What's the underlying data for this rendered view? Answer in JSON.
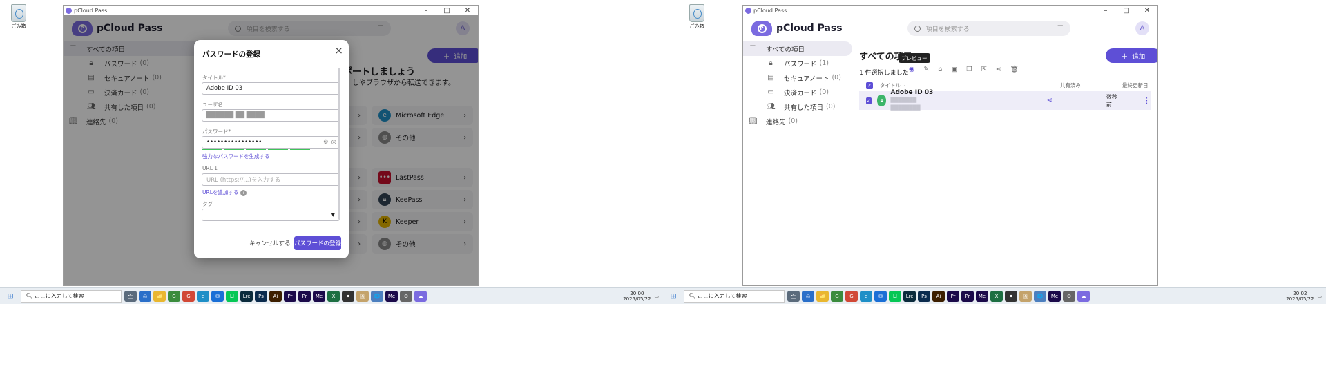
{
  "desktop": {
    "recycle_label": "ごみ箱"
  },
  "app": {
    "window_title": "pCloud Pass",
    "logo_text": "pCloud Pass",
    "search_placeholder": "項目を検索する",
    "avatar": "A",
    "add_button": "追加",
    "window_controls": {
      "min": "–",
      "max": "□",
      "close": "✕"
    }
  },
  "sidebar_left": [
    {
      "label": "すべての項目",
      "count": ""
    },
    {
      "label": "パスワード",
      "count": "(0)"
    },
    {
      "label": "セキュアノート",
      "count": "(0)"
    },
    {
      "label": "決済カード",
      "count": "(0)"
    },
    {
      "label": "共有した項目",
      "count": "(0)"
    },
    {
      "label": "連絡先",
      "count": "(0)"
    }
  ],
  "sidebar_right": [
    {
      "label": "すべての項目",
      "count": ""
    },
    {
      "label": "パスワード",
      "count": "(1)"
    },
    {
      "label": "セキュアノート",
      "count": "(0)"
    },
    {
      "label": "決済カード",
      "count": "(0)"
    },
    {
      "label": "共有した項目",
      "count": "(0)"
    },
    {
      "label": "連絡先",
      "count": "(0)"
    }
  ],
  "import": {
    "heading": "ポートしましょう",
    "subheading": "しやブラウザから転送できます。",
    "tiles": [
      "Microsoft Edge",
      "その他",
      "LastPass",
      "KeePass",
      "Keeper",
      "その他"
    ]
  },
  "modal": {
    "title": "パスワードの登録",
    "title_label": "タイトル*",
    "title_value": "Adobe ID 03",
    "username_label": "ユーザ名",
    "username_value": "██████ ██ ████",
    "password_label": "パスワード*",
    "password_value": "••••••••••••••••",
    "strength": 1.0,
    "generate_link": "強力なパスワードを生成する",
    "url_label": "URL 1",
    "url_placeholder": "URL (https://...)を入力する",
    "add_url_link": "URLを追加する",
    "tags_label": "タグ",
    "cancel": "キャンセルする",
    "submit": "パスワードの登録"
  },
  "right": {
    "page_title": "すべての項目",
    "tooltip": "プレビュー",
    "selected_text": "1 件選択しました",
    "columns": {
      "title": "タイトル",
      "shared": "共有済み",
      "updated": "最終更新日"
    },
    "row": {
      "title": "Adobe ID 03",
      "subtitle": "███████ ████████",
      "updated": "数秒前"
    }
  },
  "taskbar": {
    "search_placeholder": "ここに入力して検索",
    "left_clock": {
      "time": "20:00",
      "date": "2025/05/22"
    },
    "right_clock": {
      "time": "20:02",
      "date": "2025/05/22"
    },
    "apps": [
      "🗂",
      "◎",
      "📁",
      "G",
      "G",
      "e",
      "✉",
      "LI",
      "Lrc",
      "Ps",
      "Ai",
      "Pr",
      "Pr",
      "Me",
      "X",
      "⚫",
      "🖼",
      "🌐",
      "Me",
      "⚙",
      "☁"
    ]
  },
  "colors": {
    "accent": "#5e4fd6",
    "success": "#3ec45a"
  }
}
